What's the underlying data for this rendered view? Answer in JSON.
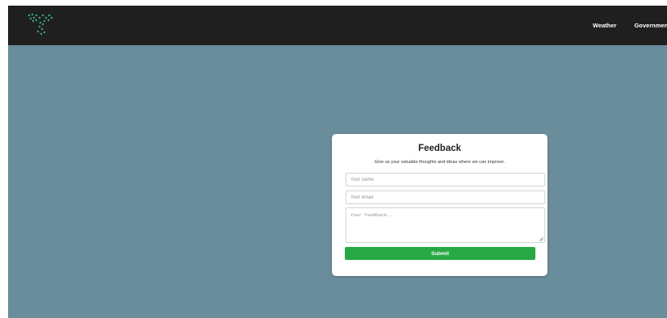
{
  "header": {
    "logo_icon": "plant-sprout-icon",
    "nav": [
      {
        "label": "Weather"
      },
      {
        "label": "Government"
      }
    ]
  },
  "feedback": {
    "title": "Feedback",
    "subtitle": "Give us your valuable thoughts and ideas where we can improve.",
    "name_placeholder": "Your name",
    "email_placeholder": "Your email",
    "feedback_placeholder": "Your feedback...",
    "submit_label": "Submit"
  },
  "colors": {
    "background": "#6a8d9c",
    "header": "#1f1f1f",
    "accent": "#27a844",
    "logo": "#3fbf8a"
  }
}
